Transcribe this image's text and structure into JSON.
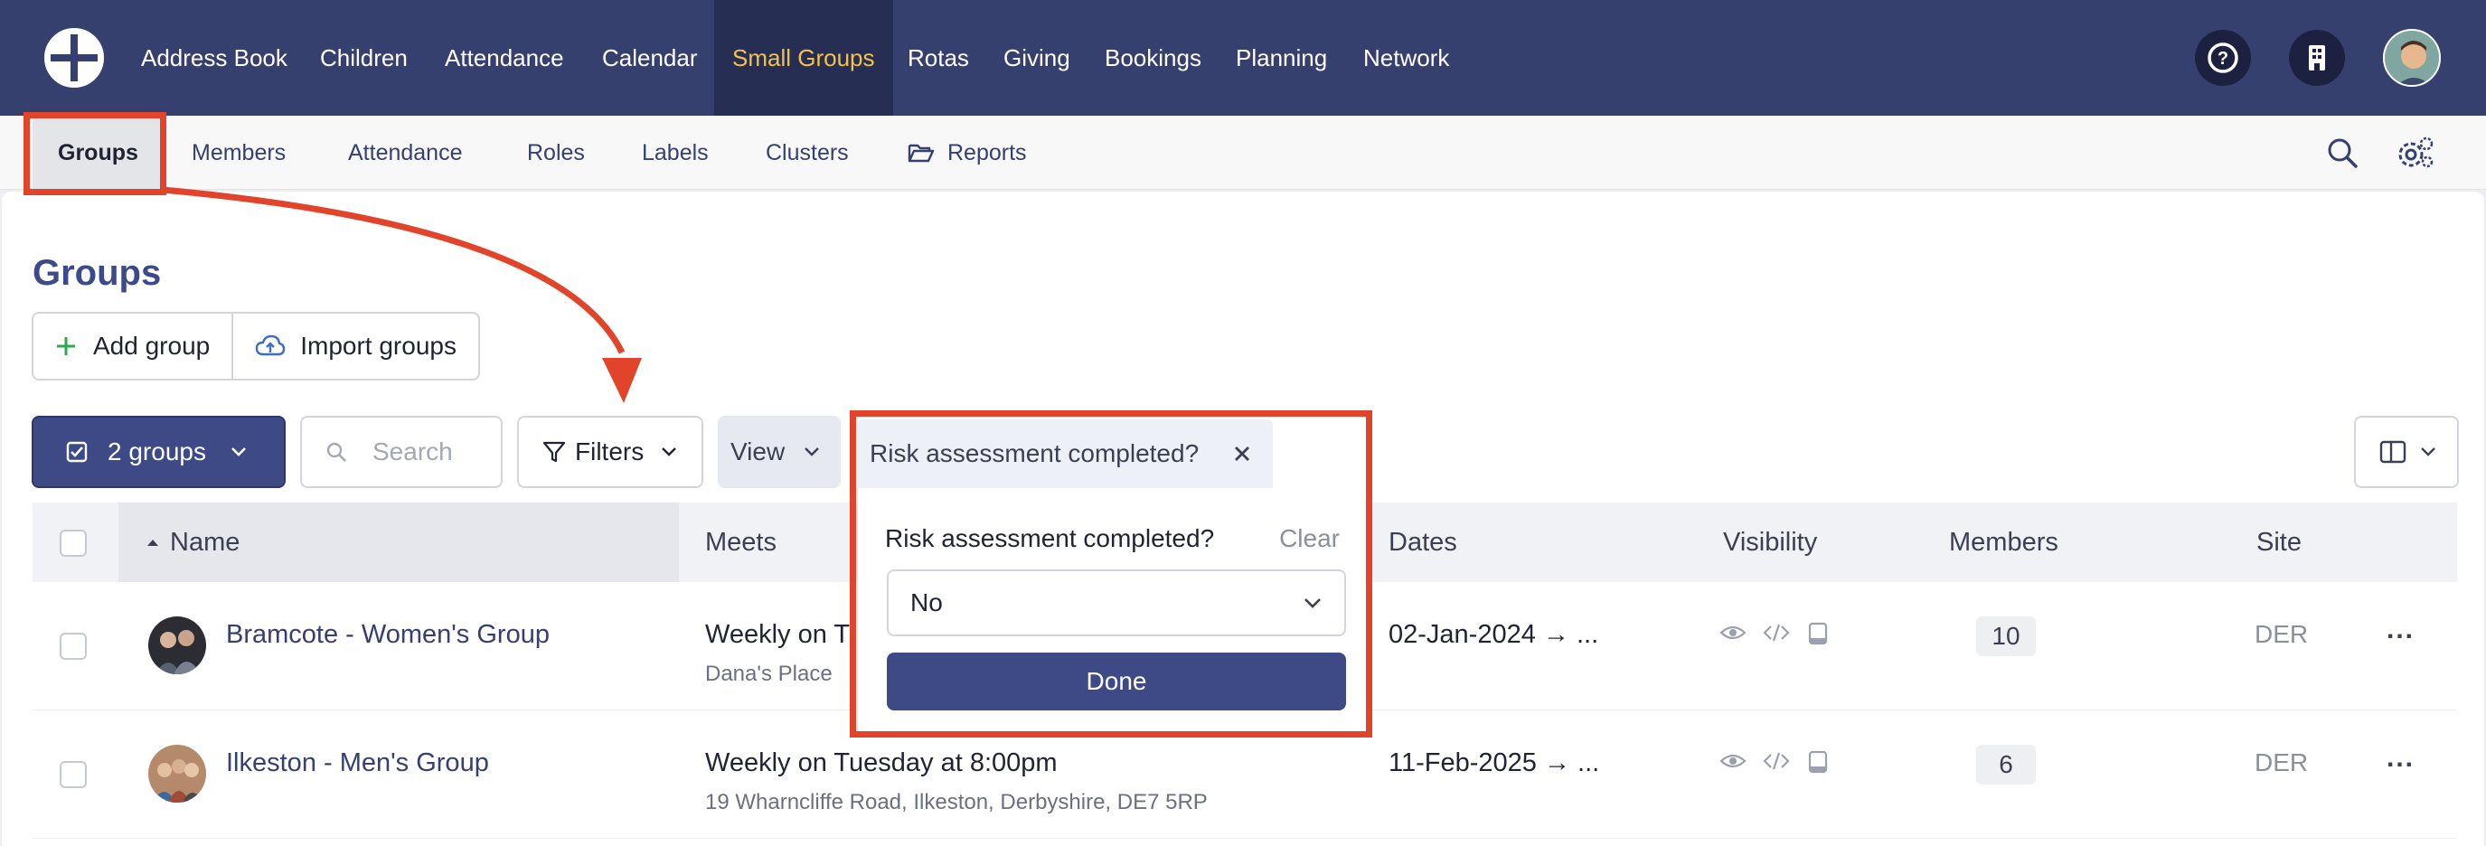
{
  "nav": {
    "items": [
      {
        "label": "Address Book"
      },
      {
        "label": "Children"
      },
      {
        "label": "Attendance"
      },
      {
        "label": "Calendar"
      },
      {
        "label": "Small Groups"
      },
      {
        "label": "Rotas"
      },
      {
        "label": "Giving"
      },
      {
        "label": "Bookings"
      },
      {
        "label": "Planning"
      },
      {
        "label": "Network"
      }
    ],
    "active": "Small Groups",
    "icons": [
      "help-icon",
      "building-icon",
      "user-avatar"
    ]
  },
  "subnav": {
    "items": [
      {
        "label": "Groups"
      },
      {
        "label": "Members"
      },
      {
        "label": "Attendance"
      },
      {
        "label": "Roles"
      },
      {
        "label": "Labels"
      },
      {
        "label": "Clusters"
      },
      {
        "label": "Reports"
      }
    ],
    "active": "Groups",
    "icons": [
      "search-icon",
      "settings-icon"
    ]
  },
  "page": {
    "title": "Groups",
    "add_group": "Add group",
    "import_groups": "Import groups"
  },
  "toolbar": {
    "groups_count": "2 groups",
    "search_placeholder": "Search",
    "filters": "Filters",
    "view": "View"
  },
  "filter": {
    "chip_label": "Risk assessment completed?",
    "popover_label": "Risk assessment completed?",
    "clear": "Clear",
    "selected": "No",
    "done": "Done"
  },
  "table": {
    "headers": {
      "name": "Name",
      "meets": "Meets",
      "dates": "Dates",
      "visibility": "Visibility",
      "members": "Members",
      "site": "Site"
    },
    "rows": [
      {
        "name": "Bramcote - Women's Group",
        "meets": "Weekly on T",
        "location": "Dana's Place",
        "dates": "02-Jan-2024  →  ...",
        "members": "10",
        "site": "DER",
        "more": "..."
      },
      {
        "name": "Ilkeston - Men's Group",
        "meets": "Weekly on Tuesday at 8:00pm",
        "location": "19 Wharncliffe Road, Ilkeston, Derbyshire, DE7 5RP",
        "dates": "11-Feb-2025  →  ...",
        "members": "6",
        "site": "DER",
        "more": "..."
      }
    ]
  },
  "colors": {
    "nav_bg": "#36406f",
    "nav_active_text": "#f2c24b",
    "primary": "#3e4a86",
    "highlight": "#e2442b"
  }
}
